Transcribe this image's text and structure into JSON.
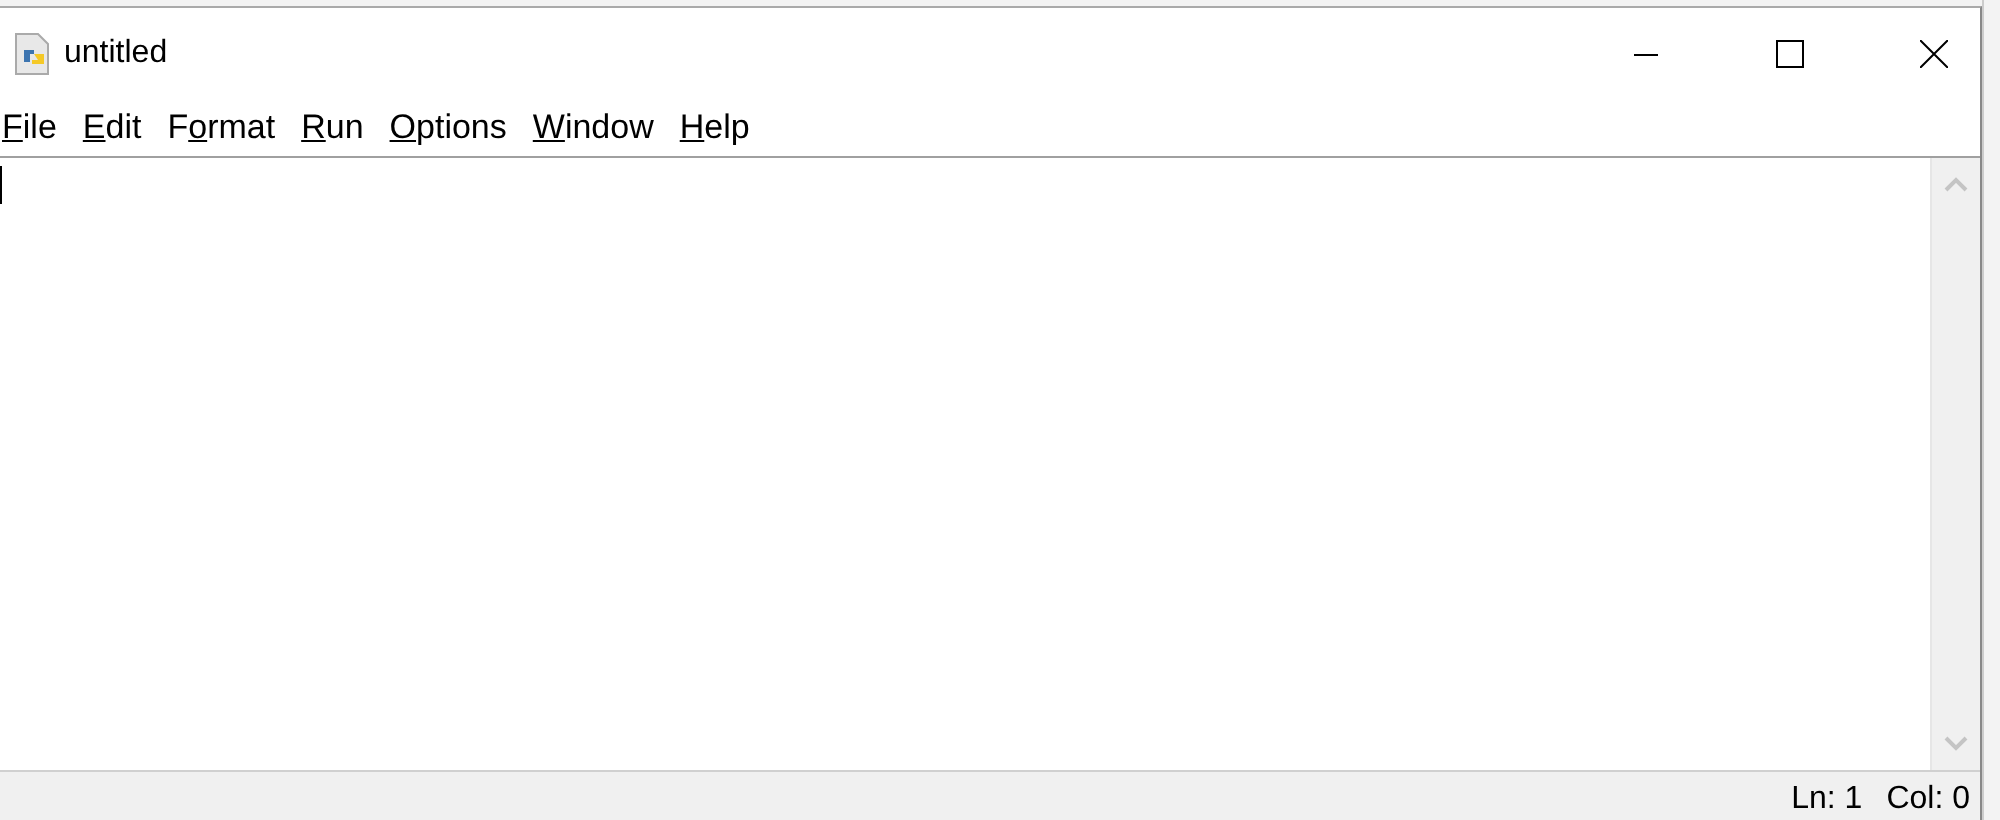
{
  "window": {
    "title": "untitled"
  },
  "menu": [
    {
      "access_key": "F",
      "rest": "ile"
    },
    {
      "access_key": "E",
      "rest": "dit"
    },
    {
      "lead": "F",
      "access_key": "o",
      "rest": "rmat"
    },
    {
      "access_key": "R",
      "rest": "un"
    },
    {
      "access_key": "O",
      "rest": "ptions"
    },
    {
      "access_key": "W",
      "rest": "indow"
    },
    {
      "access_key": "H",
      "rest": "elp"
    }
  ],
  "status_bar": {
    "line": "Ln: 1",
    "column": "Col: 0"
  }
}
